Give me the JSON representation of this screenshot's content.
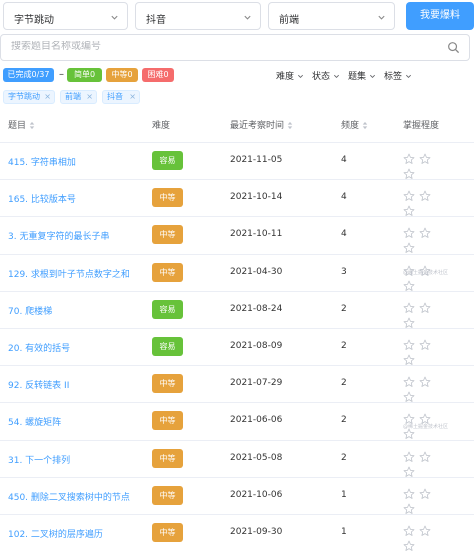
{
  "filters_top": {
    "company": "字节跳动",
    "platform": "抖音",
    "role": "前端",
    "submit_label": "我要爆料"
  },
  "search": {
    "placeholder": "搜索题目名称或编号"
  },
  "progress": {
    "done_label": "已完成0/37",
    "dash": "–",
    "easy_label": "简单0",
    "medium_label": "中等0",
    "hard_label": "困难0"
  },
  "filter_menu": {
    "difficulty": "难度",
    "status": "状态",
    "topic": "题集",
    "tag": "标签"
  },
  "active_tags": [
    "字节跳动",
    "前端",
    "抖音"
  ],
  "table": {
    "headers": {
      "title": "题目",
      "difficulty": "难度",
      "last_seen": "最近考察时间",
      "frequency": "频度",
      "mastery": "掌握程度"
    },
    "rows": [
      {
        "title": "415. 字符串相加",
        "difficulty": "容易",
        "date": "2021-11-05",
        "freq": "4",
        "mastery": 0
      },
      {
        "title": "165. 比较版本号",
        "difficulty": "中等",
        "date": "2021-10-14",
        "freq": "4",
        "mastery": 0
      },
      {
        "title": "3. 无重复字符的最长子串",
        "difficulty": "中等",
        "date": "2021-10-11",
        "freq": "4",
        "mastery": 0
      },
      {
        "title": "129. 求根到叶子节点数字之和",
        "difficulty": "中等",
        "date": "2021-04-30",
        "freq": "3",
        "mastery": 0
      },
      {
        "title": "70. 爬楼梯",
        "difficulty": "容易",
        "date": "2021-08-24",
        "freq": "2",
        "mastery": 0
      },
      {
        "title": "20. 有效的括号",
        "difficulty": "容易",
        "date": "2021-08-09",
        "freq": "2",
        "mastery": 0
      },
      {
        "title": "92. 反转链表 II",
        "difficulty": "中等",
        "date": "2021-07-29",
        "freq": "2",
        "mastery": 0
      },
      {
        "title": "54. 螺旋矩阵",
        "difficulty": "中等",
        "date": "2021-06-06",
        "freq": "2",
        "mastery": 0
      },
      {
        "title": "31. 下一个排列",
        "difficulty": "中等",
        "date": "2021-05-08",
        "freq": "2",
        "mastery": 0
      },
      {
        "title": "450. 删除二叉搜索树中的节点",
        "difficulty": "中等",
        "date": "2021-10-06",
        "freq": "1",
        "mastery": 0
      },
      {
        "title": "102. 二叉树的层序遍历",
        "difficulty": "中等",
        "date": "2021-09-30",
        "freq": "1",
        "mastery": 0
      }
    ]
  },
  "watermark": "@稀土掘金技术社区",
  "colors": {
    "primary": "#409eff",
    "easy": "#67c23a",
    "medium": "#e6a23c",
    "hard": "#f56c6c",
    "star_empty": "#c0c4cc"
  },
  "icons": {
    "select_arrow": "chevron-down-icon",
    "search": "search-icon",
    "sort": "sort-icon",
    "filter_arrow": "caret-down-icon",
    "tag_close": "close-icon",
    "mastery": "star-icon"
  }
}
